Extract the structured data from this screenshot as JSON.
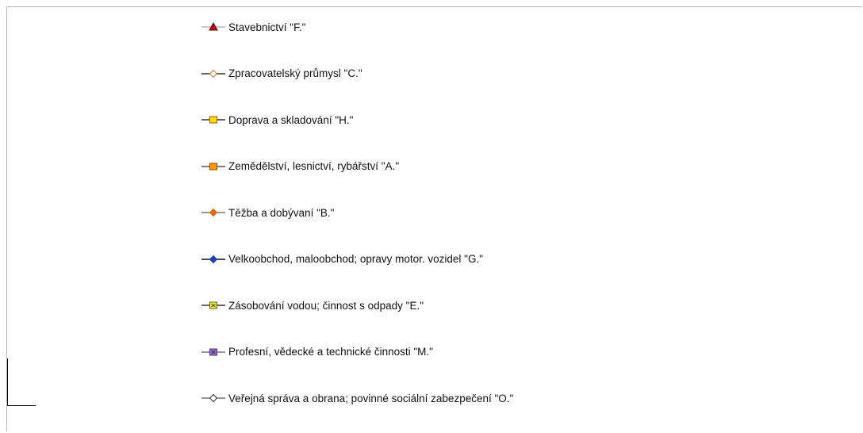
{
  "chart_data": {
    "type": "line",
    "legend": [
      {
        "label": "Stavebnictví \"F.\"",
        "line_color": "#b9b5d6",
        "marker": "triangle",
        "marker_color": "#c00000",
        "marker_edge": "#600000"
      },
      {
        "label": "Zpracovatelský průmysl \"C.\"",
        "line_color": "#333333",
        "marker": "diamond",
        "marker_color": "#ffffff",
        "marker_edge": "#c87a2a"
      },
      {
        "label": "Doprava a skladování \"H.\"",
        "line_color": "#333333",
        "marker": "square",
        "marker_color": "#ffe000",
        "marker_edge": "#b05000"
      },
      {
        "label": "Zemědělství, lesnictví, rybářství \"A.\"",
        "line_color": "#555555",
        "marker": "square",
        "marker_color": "#ff9a00",
        "marker_edge": "#a04000"
      },
      {
        "label": "Těžba a dobývaní \"B.\"",
        "line_color": "#777777",
        "marker": "diamond",
        "marker_color": "#e06a10",
        "marker_edge": "#e06a10"
      },
      {
        "label": "Velkoobchod, maloobchod; opravy motor. vozidel \"G.\"",
        "line_color": "#111111",
        "marker": "diamond",
        "marker_color": "#1f3fbf",
        "marker_edge": "#1f3fbf"
      },
      {
        "label": "Zásobování vodou; činnost s odpady \"E.\"",
        "line_color": "#333333",
        "marker": "x-square",
        "marker_color": "#ffff00",
        "marker_edge": "#555555"
      },
      {
        "label": "Profesní, vědecké a technické činnosti \"M.\"",
        "line_color": "#777777",
        "marker": "x-square",
        "marker_color": "#9b6bd6",
        "marker_edge": "#5b2b96"
      },
      {
        "label": "Veřejná správa a obrana; povinné sociální zabezpečení \"O.\"",
        "line_color": "#777777",
        "marker": "diamond",
        "marker_color": "#ffffff",
        "marker_edge": "#333333"
      }
    ]
  }
}
